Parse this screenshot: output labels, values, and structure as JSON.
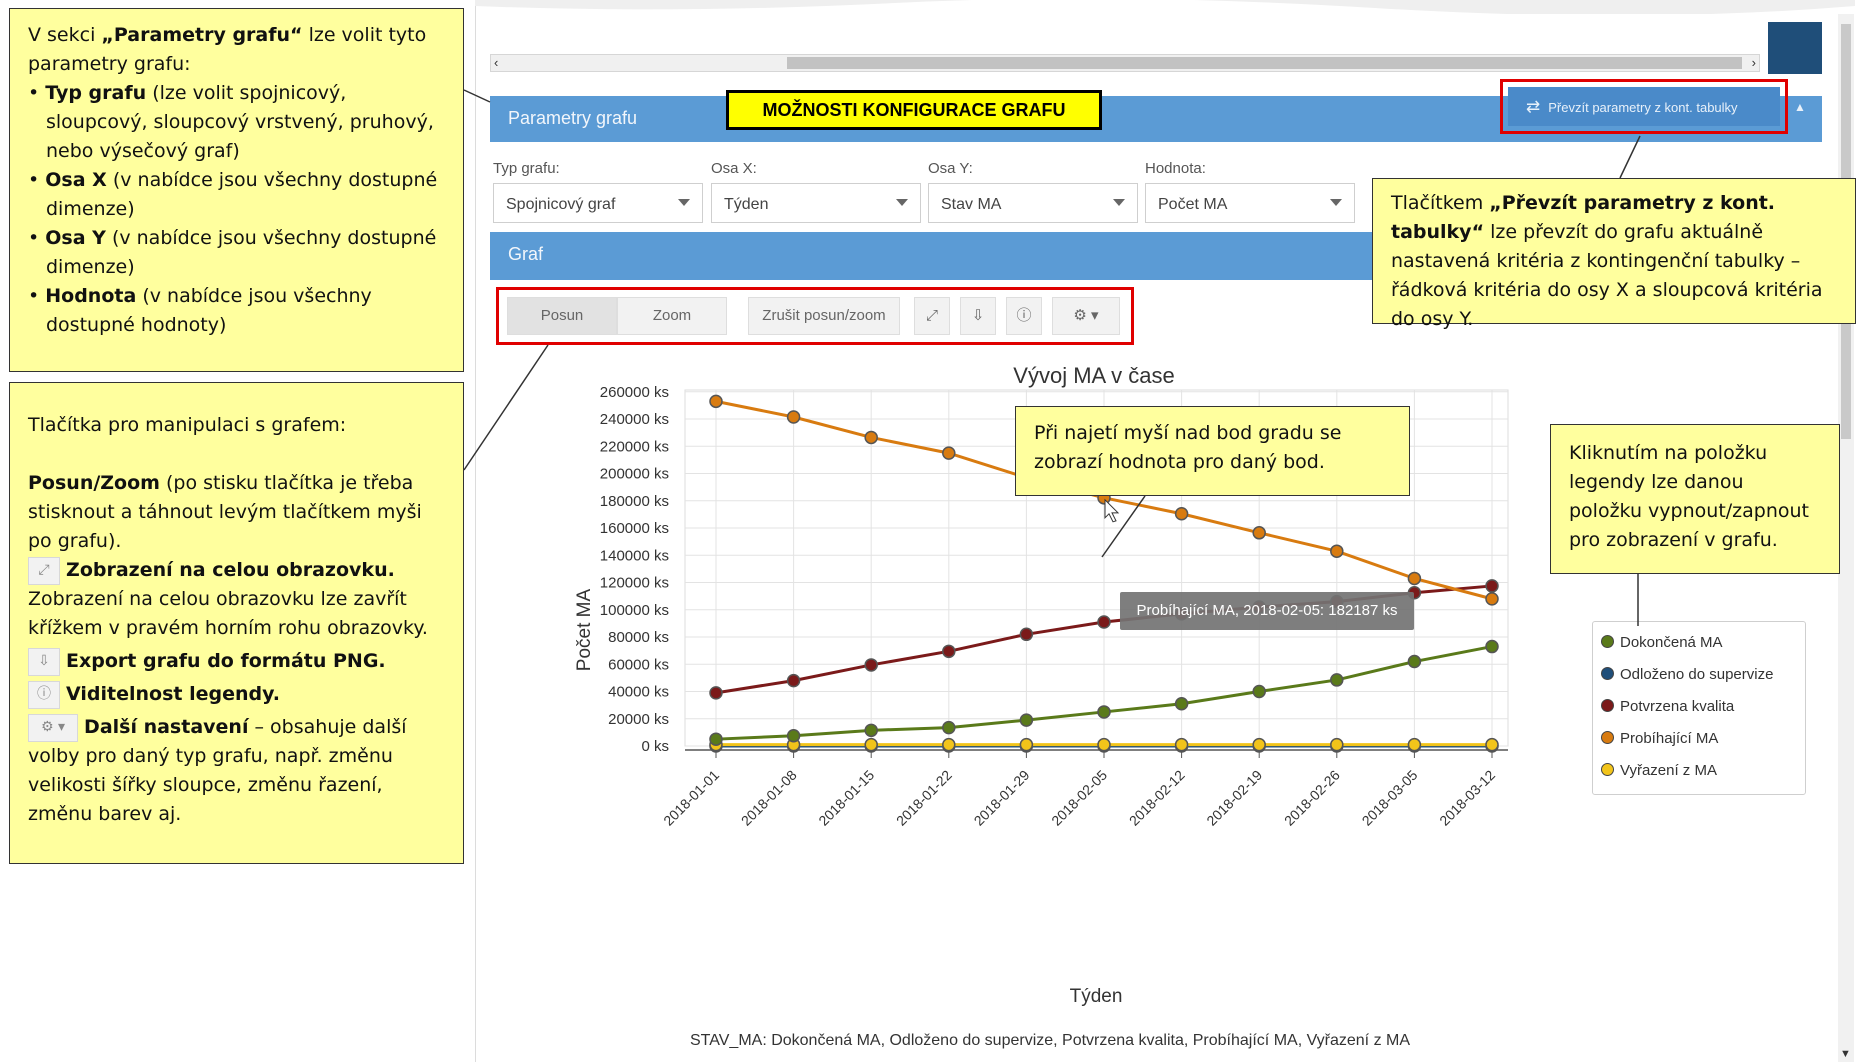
{
  "notes": {
    "params": {
      "intro_a": "V sekci ",
      "intro_b": "„Parametry grafu“",
      "intro_c": " lze volit tyto parametry grafu:",
      "items": [
        {
          "term": "Typ grafu",
          "desc": " (lze volit spojnicový, sloupcový, sloupcový vrstvený, pruhový, nebo výsečový graf)"
        },
        {
          "term": "Osa X",
          "desc": " (v nabídce jsou všechny dostupné dimenze)"
        },
        {
          "term": "Osa Y",
          "desc": " (v nabídce jsou všechny dostupné dimenze)"
        },
        {
          "term": "Hodnota",
          "desc": " (v nabídce jsou všechny dostupné hodnoty)"
        }
      ]
    },
    "buttons": {
      "heading": "Tlačítka pro manipulaci s grafem:",
      "posun_term": "Posun/Zoom",
      "posun_desc": " (po stisku tlačítka je třeba stisknout a táhnout levým tlačítkem myši po grafu).",
      "fullscreen_term": "Zobrazení na celou obrazovku.",
      "fullscreen_desc": "Zobrazení na celou obrazovku lze zavřít křížkem v pravém horním rohu obrazovky.",
      "export_term": "Export grafu do formátu PNG.",
      "legend_term": "Viditelnost legendy.",
      "more_term": "Další nastavení",
      "more_desc": " – obsahuje další volby pro daný typ grafu, např. změnu velikosti šířky sloupce, změnu řazení, změnu barev aj."
    },
    "transfer": {
      "a": "Tlačítkem ",
      "b": "„Převzít parametry z kont. tabulky“",
      "c": " lze převzít do grafu aktuálně nastavená kritéria z kontingenční tabulky – řádková kritéria do osy X a sloupcová kritéria do osy Y."
    },
    "hover": "Při najetí myší nad bod gradu se zobrazí hodnota pro daný bod.",
    "legend_click": "Kliknutím na položku legendy lze danou položku vypnout/zapnout pro zobrazení v grafu."
  },
  "ui": {
    "params_bar_title": "Parametry grafu",
    "config_banner": "MOŽNOSTI KONFIGURACE GRAFU",
    "take_params_button": "Převzít parametry z kont. tabulky",
    "graph_bar_title": "Graf",
    "fields": [
      {
        "label": "Typ grafu:",
        "value": "Spojnicový graf"
      },
      {
        "label": "Osa X:",
        "value": "Týden"
      },
      {
        "label": "Osa Y:",
        "value": "Stav MA"
      },
      {
        "label": "Hodnota:",
        "value": "Počet MA"
      }
    ],
    "toolbar": {
      "pan": "Posun",
      "zoom": "Zoom",
      "reset": "Zrušit posun/zoom",
      "fullscreen_icon": "expand-icon",
      "download_icon": "download-icon",
      "info_icon": "info-icon",
      "settings_icon": "gear-icon"
    },
    "tooltip": "Probíhající MA, 2018-02-05: 182187 ks",
    "caption": "STAV_MA: Dokončená MA, Odloženo do supervize, Potvrzena kvalita, Probíhající MA, Vyřazení z MA"
  },
  "chart_data": {
    "type": "line",
    "title": "Vývoj MA v čase",
    "xlabel": "Týden",
    "ylabel": "Počet MA",
    "y_unit": "ks",
    "ylim": [
      0,
      260000
    ],
    "y_ticks": [
      0,
      20000,
      40000,
      60000,
      80000,
      100000,
      120000,
      140000,
      160000,
      180000,
      200000,
      220000,
      240000,
      260000
    ],
    "grid": true,
    "legend_position": "right",
    "categories": [
      "2018-01-01",
      "2018-01-08",
      "2018-01-15",
      "2018-01-22",
      "2018-01-29",
      "2018-02-05",
      "2018-02-12",
      "2018-02-19",
      "2018-02-26",
      "2018-03-05",
      "2018-03-12"
    ],
    "series": [
      {
        "name": "Dokončená MA",
        "color": "#5a7a1a",
        "values": [
          5000,
          7500,
          11500,
          13500,
          19000,
          25000,
          31000,
          40000,
          48500,
          62000,
          73000
        ]
      },
      {
        "name": "Odloženo do supervize",
        "color": "#1f4e79",
        "values": [
          0,
          0,
          0,
          0,
          0,
          0,
          0,
          0,
          0,
          0,
          0
        ]
      },
      {
        "name": "Potvrzena kvalita",
        "color": "#7b1a1a",
        "values": [
          39000,
          48000,
          59500,
          69500,
          82000,
          91000,
          97000,
          102000,
          106000,
          112500,
          117500
        ]
      },
      {
        "name": "Probíhající MA",
        "color": "#d87b10",
        "values": [
          253000,
          241500,
          226500,
          215000,
          197000,
          182187,
          170500,
          156500,
          143000,
          123000,
          108000
        ]
      },
      {
        "name": "Vyřazení z MA",
        "color": "#f2c41a",
        "values": [
          1000,
          1000,
          1000,
          1000,
          1000,
          1000,
          1000,
          1000,
          1000,
          1000,
          1000
        ]
      }
    ]
  }
}
